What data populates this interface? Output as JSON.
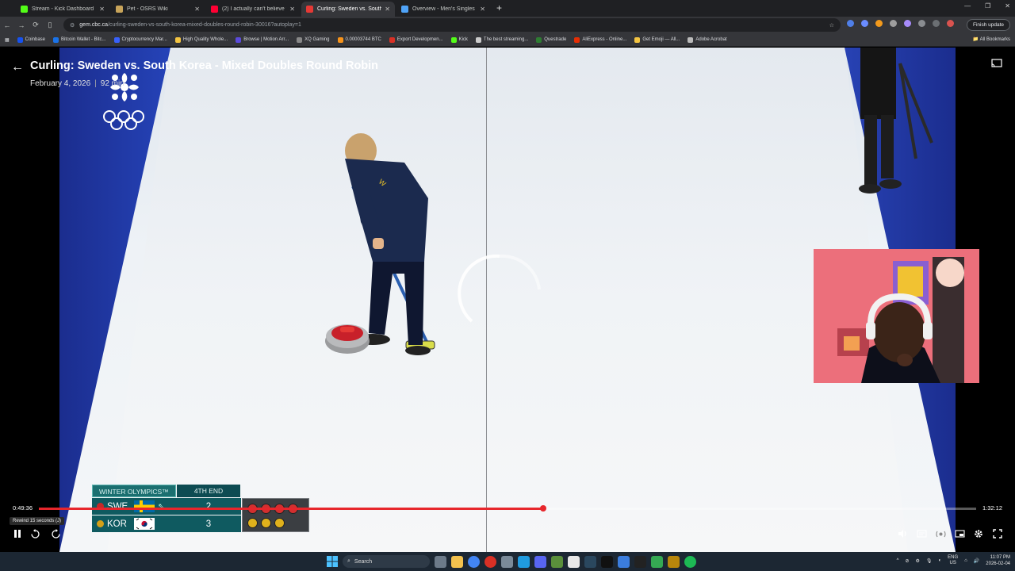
{
  "browser": {
    "tabs": [
      {
        "title": "Stream - Kick Dashboard",
        "favicon_color": "#53fc18",
        "active": false
      },
      {
        "title": "Pet - OSRS Wiki",
        "favicon_color": "#c8a45a",
        "active": false
      },
      {
        "title": "(2) I actually can't believe this...",
        "favicon_color": "#ff0033",
        "active": false
      },
      {
        "title": "Curling: Sweden vs. South K",
        "favicon_color": "#e53935",
        "active": true
      },
      {
        "title": "Overview - Men's Singles | Mil...",
        "favicon_color": "#4fa3f7",
        "active": false
      }
    ],
    "new_tab": "+",
    "url_host": "gem.cbc.ca",
    "url_path": "/curling-sweden-vs-south-korea-mixed-doubles-round-robin-30016?autoplay=1",
    "finish_update": "Finish update",
    "bookmarks": [
      {
        "label": "Coinbase",
        "color": "#1652f0"
      },
      {
        "label": "Bitcoin Wallet - Bitc...",
        "color": "#1a73e8"
      },
      {
        "label": "Cryptocurrency Mar...",
        "color": "#3861fb"
      },
      {
        "label": "High Quality Whole...",
        "color": "#f4c542"
      },
      {
        "label": "Browse | Motion Arr...",
        "color": "#5b4bdb"
      },
      {
        "label": "XQ Gaming",
        "color": "#888888"
      },
      {
        "label": "0.00003744 BTC",
        "color": "#f7931a"
      },
      {
        "label": "Export Developmen...",
        "color": "#d93025"
      },
      {
        "label": "Kick",
        "color": "#53fc18"
      },
      {
        "label": "The best streaming...",
        "color": "#cccccc"
      },
      {
        "label": "Questrade",
        "color": "#2e7d32"
      },
      {
        "label": "AliExpress - Online...",
        "color": "#e62e04"
      },
      {
        "label": "Get Emoji — All...",
        "color": "#f4c542"
      },
      {
        "label": "Adobe Acrobat",
        "color": "#bbbbbb"
      }
    ],
    "all_bookmarks": "All Bookmarks"
  },
  "video": {
    "title": "Curling: Sweden vs. South Korea - Mixed Doubles Round Robin",
    "date": "February 4, 2026",
    "duration_label": "92 min",
    "current_time": "0:49:36",
    "total_time": "1:32:12",
    "progress_fraction": 0.538,
    "tooltip": "Rewind 15 seconds (J)"
  },
  "scorebug": {
    "competition": "WINTER OLYMPICS™",
    "end_label": "4TH END",
    "teams": [
      {
        "code": "SWE",
        "score": "2",
        "dot_color": "#c62828",
        "hammer": "⇖",
        "stones": 4,
        "stone_color": "#d32f2f"
      },
      {
        "code": "KOR",
        "score": "3",
        "dot_color": "#d4a017",
        "hammer": "",
        "stones": 3,
        "stone_color": "#e0b11c"
      }
    ]
  },
  "taskbar": {
    "search": "Search",
    "lang_top": "ENG",
    "lang_bottom": "US",
    "time": "11:07 PM",
    "date": "2026-02-04"
  },
  "colors": {
    "accent_red": "#e7262c",
    "scorebug_teal": "#0f5a60"
  }
}
